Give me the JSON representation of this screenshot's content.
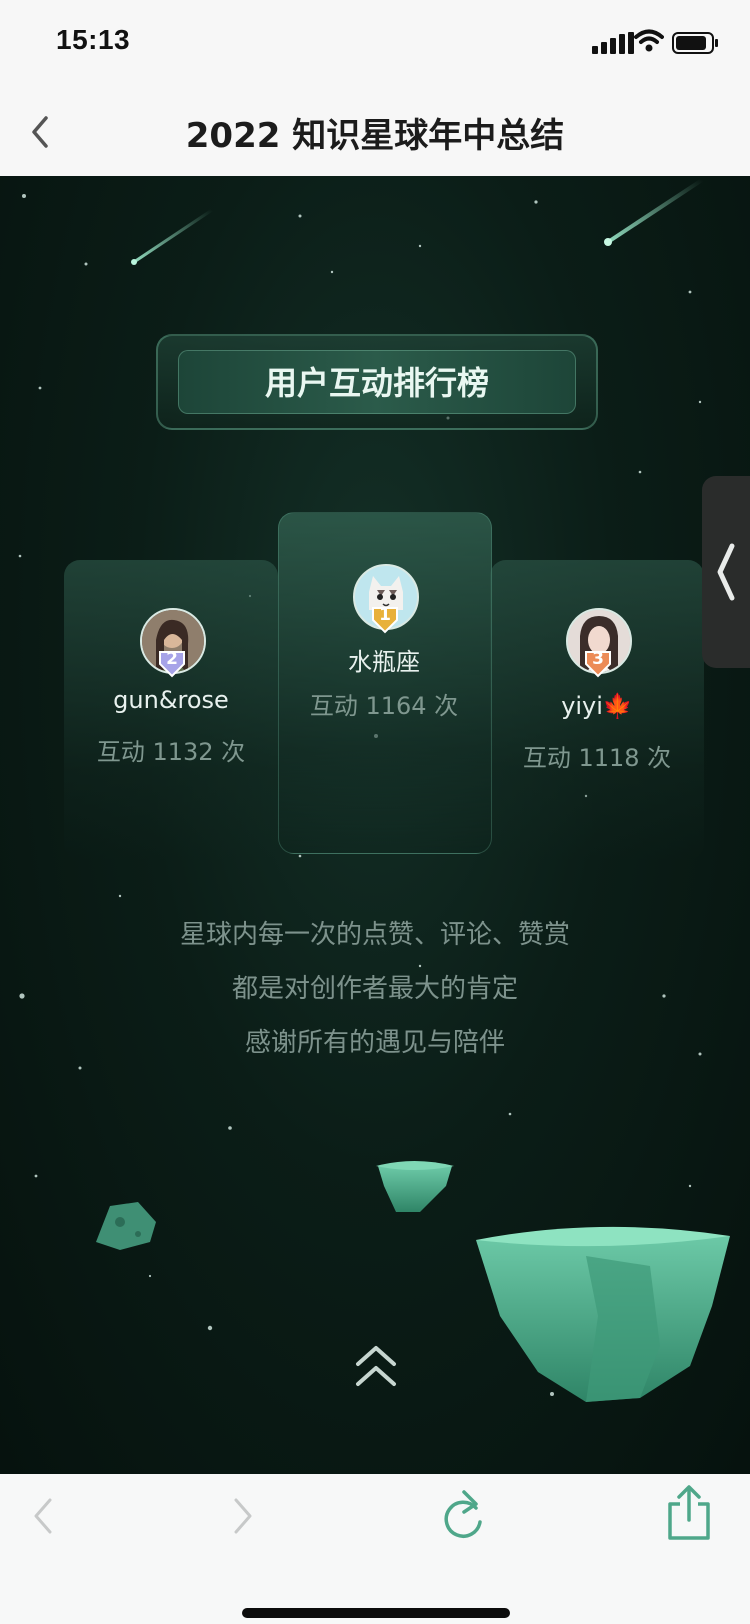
{
  "status_bar": {
    "time": "15:13"
  },
  "nav": {
    "title": "2022 知识星球年中总结"
  },
  "section": {
    "title": "用户互动排行榜"
  },
  "ranking": [
    {
      "rank": "1",
      "name": "水瓶座",
      "count": "互动 1164 次"
    },
    {
      "rank": "2",
      "name": "gun&rose",
      "count": "互动 1132 次"
    },
    {
      "rank": "3",
      "name": "yiyi🍁",
      "count": "互动 1118 次"
    }
  ],
  "description": [
    "星球内每一次的点赞、评论、赞赏",
    "都是对创作者最大的肯定",
    "感谢所有的遇见与陪伴"
  ],
  "colors": {
    "accent": "#4fa78a",
    "gold": "#e8b13a",
    "silver": "#a7a3e8",
    "bronze": "#ec8b57"
  },
  "icons": [
    "back-icon",
    "signal-icon",
    "wifi-icon",
    "battery-icon",
    "scroll-up-icon",
    "collapse-handle-icon",
    "reload-icon",
    "share-icon"
  ]
}
